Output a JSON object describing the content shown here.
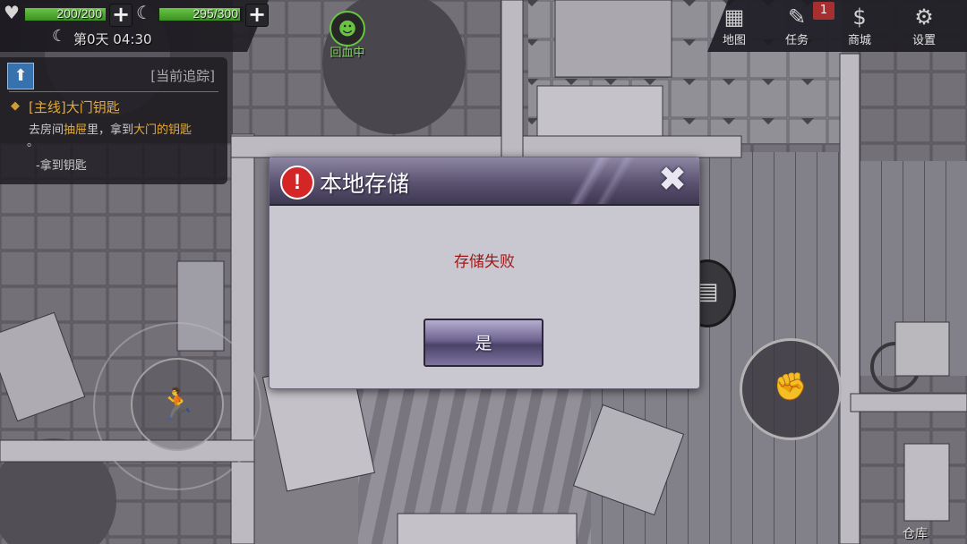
{
  "hud": {
    "hp": {
      "current": 200,
      "max": 200,
      "text": "200/200"
    },
    "stamina": {
      "current": 295,
      "max": 300,
      "text": "295/300"
    },
    "day_time": "第0天 04:30",
    "recover_label": "回血中",
    "bar_color": "#5fbf3a"
  },
  "menu": {
    "items": [
      {
        "label": "地图",
        "icon": "map-icon"
      },
      {
        "label": "任务",
        "icon": "task-icon",
        "badge": "1"
      },
      {
        "label": "商城",
        "icon": "shop-icon"
      },
      {
        "label": "设置",
        "icon": "gear-icon"
      }
    ]
  },
  "quest": {
    "header": "[当前追踪]",
    "title": "[主线]大门钥匙",
    "desc_prefix": "去房间",
    "desc_hl1": "抽屉",
    "desc_mid": "里，拿到",
    "desc_hl2": "大门的钥匙",
    "desc_end": "。",
    "sub": "-拿到钥匙"
  },
  "controls": {
    "warehouse_label": "仓库"
  },
  "dialog": {
    "title": "本地存储",
    "message": "存储失败",
    "ok_label": "是",
    "message_color": "#a01818"
  }
}
